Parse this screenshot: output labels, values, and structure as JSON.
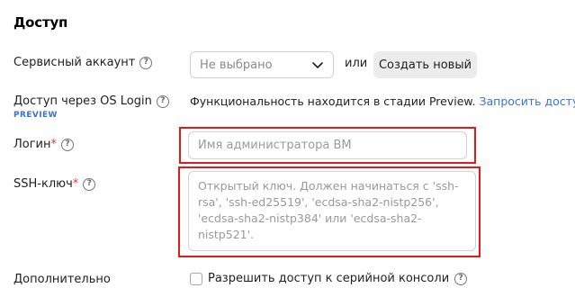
{
  "section": {
    "title": "Доступ"
  },
  "service_account": {
    "label": "Сервисный аккаунт",
    "select_value": "Не выбрано",
    "or_text": "или",
    "create_button": "Создать новый"
  },
  "os_login": {
    "label": "Доступ через OS Login",
    "tag": "PREVIEW",
    "info_text": "Функциональность находится в стадии Preview.",
    "link_text": "Запросить доступ."
  },
  "login": {
    "label": "Логин",
    "required_mark": "*",
    "placeholder": "Имя администратора ВМ"
  },
  "ssh_key": {
    "label": "SSH-ключ",
    "required_mark": "*",
    "placeholder": "Открытый ключ. Должен начинаться с 'ssh-rsa', 'ssh-ed25519', 'ecdsa-sha2-nistp256', 'ecdsa-sha2-nistp384' или 'ecdsa-sha2-nistp521'."
  },
  "additional": {
    "label": "Дополнительно",
    "serial_console_label": "Разрешить доступ к серийной консоли"
  },
  "colors": {
    "accent_link": "#3a73d6",
    "required_mark": "#e23b2e",
    "highlight_box": "#e21a1a"
  },
  "icons": {
    "help": "question-circle-icon",
    "dropdown": "chevron-down-icon"
  }
}
